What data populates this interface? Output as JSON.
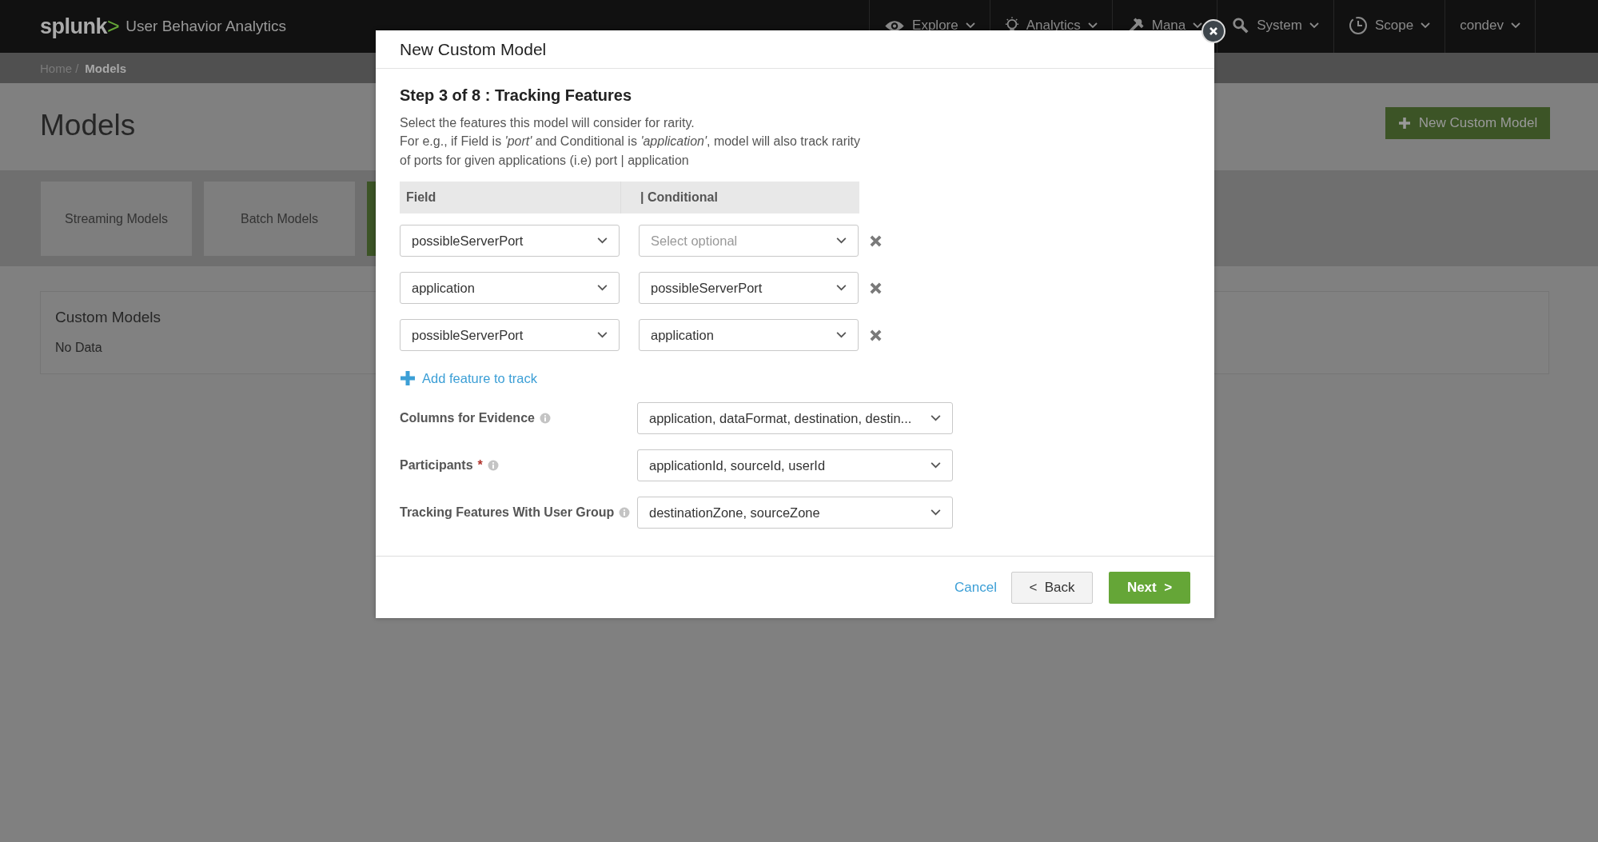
{
  "top_bar": {
    "logo_word": "splunk",
    "logo_mark": ">",
    "product": "User Behavior Analytics",
    "nav": [
      {
        "label": "Explore",
        "kind": "eye"
      },
      {
        "label": "Analytics",
        "kind": "bulb"
      },
      {
        "label": "Mana",
        "kind": "tools"
      },
      {
        "label": "System",
        "kind": "search"
      },
      {
        "label": "Scope",
        "kind": "clock"
      },
      {
        "label": "condev",
        "kind": "user"
      }
    ]
  },
  "breadcrumb": [
    {
      "label": "Home /",
      "current": false
    },
    {
      "label": "Models",
      "current": true
    }
  ],
  "page": {
    "title": "Models",
    "new_button": "New Custom Model",
    "tabs": [
      {
        "label": "Streaming Models",
        "selected": false
      },
      {
        "label": "Batch Models",
        "selected": false
      },
      {
        "selected": true
      }
    ],
    "panel": {
      "title": "Custom Models",
      "empty": "No Data"
    }
  },
  "modal": {
    "title": "New Custom Model",
    "step": "Step 3 of 8 : Tracking Features",
    "description": [
      "Select the features this model will consider for rarity.",
      "For e.g., if Field is *'port'* and Conditional is *'application'*, model will also track rarity",
      "of ports for given applications (i.e) port | application"
    ],
    "columns": [
      "Field",
      "| Conditional"
    ],
    "rows": [
      {
        "field": "possibleServerPort",
        "conditional": "",
        "conditional_placeholder": "Select optional"
      },
      {
        "field": "application",
        "conditional": "possibleServerPort"
      },
      {
        "field": "possibleServerPort",
        "conditional": "application"
      }
    ],
    "add_link": "Add feature to track",
    "settings": [
      {
        "label": "Columns for Evidence",
        "value": "application, dataFormat, destination, destin..."
      },
      {
        "label": "Participants",
        "required_mark": "*",
        "value": "applicationId, sourceId, userId"
      },
      {
        "label": "Tracking Features With User Group",
        "value": "destinationZone, sourceZone"
      }
    ],
    "buttons": [
      {
        "label": "Cancel",
        "kind": "link"
      },
      {
        "label": "<  Back",
        "kind": "secondary"
      },
      {
        "label": "Next  >",
        "kind": "primary"
      }
    ]
  }
}
